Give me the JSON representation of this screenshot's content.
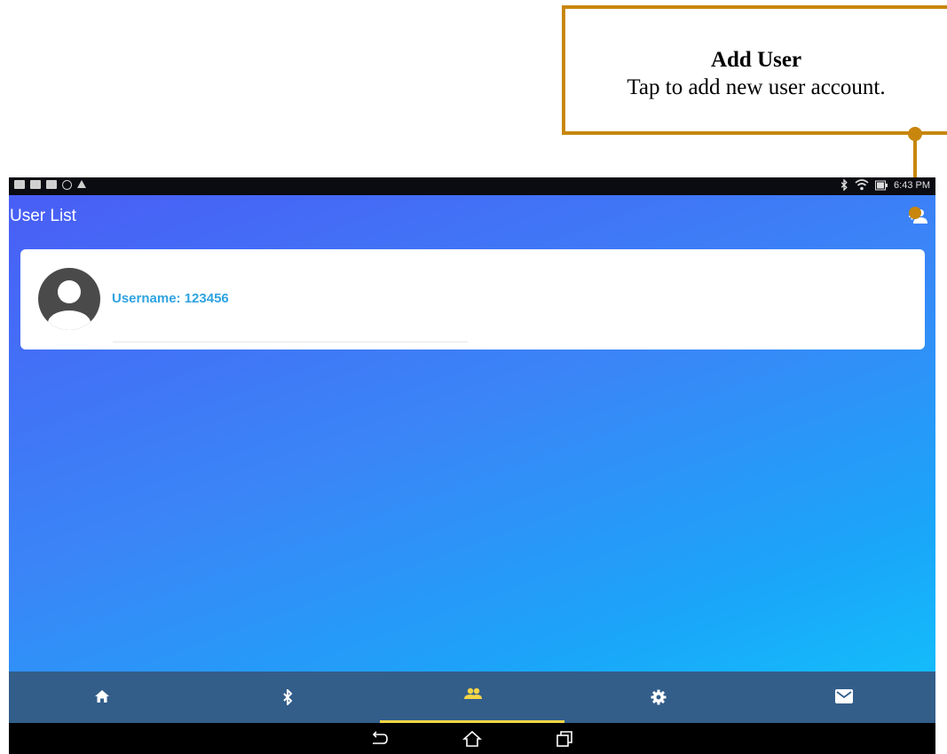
{
  "callout": {
    "title": "Add User",
    "text": "Tap to add new user account.",
    "color": "#c8860d"
  },
  "statusbar": {
    "time": "6:43 PM",
    "icons": [
      "notification-icon",
      "image-icon",
      "card-icon",
      "blocked-icon",
      "warning-icon",
      "bluetooth-icon",
      "wifi-icon",
      "battery-icon"
    ]
  },
  "header": {
    "title": "User List",
    "add_user_icon": "person-add-icon"
  },
  "user_list": [
    {
      "username": "Username: 123456",
      "avatar_icon": "account-circle-icon"
    }
  ],
  "navbar": {
    "items": [
      {
        "icon": "home-icon",
        "active": false
      },
      {
        "icon": "bluetooth-icon",
        "active": false
      },
      {
        "icon": "users-icon",
        "active": true
      },
      {
        "icon": "settings-icon",
        "active": false
      },
      {
        "icon": "mail-icon",
        "active": false
      }
    ],
    "active_color": "#f5d547"
  },
  "system_nav": [
    "back-icon",
    "home-outline-icon",
    "recents-icon"
  ]
}
